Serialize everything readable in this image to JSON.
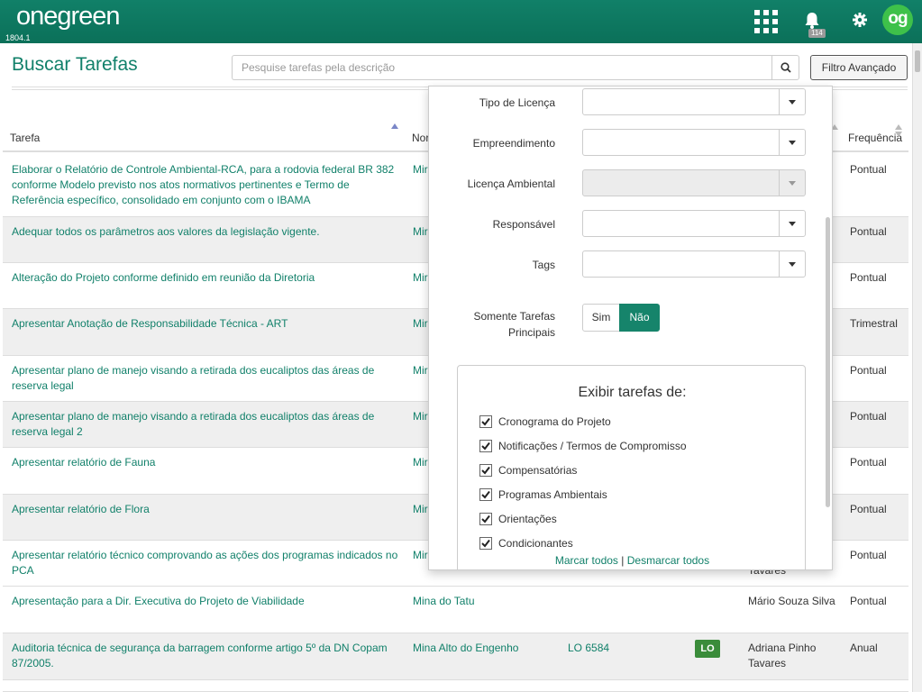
{
  "app": {
    "logo": "onegreen",
    "version": "1804.1",
    "notifications_count": "114",
    "avatar_initials": "og",
    "brand_color": "#0d7a63"
  },
  "header": {
    "title": "Buscar Tarefas",
    "search_placeholder": "Pesquise tarefas pela descrição",
    "advanced_filter_label": "Filtro Avançado"
  },
  "table": {
    "columns": {
      "task": "Tarefa",
      "name": "Nor",
      "frequency": "Frequência"
    },
    "rows": [
      {
        "task": "Elaborar o Relatório de Controle Ambiental-RCA, para a rodovia federal BR 382 conforme Modelo previsto nos atos normativos pertinentes e Termo de Referência específico, consolidado em conjunto com o IBAMA",
        "emp": "Mir",
        "freq": "Pontual"
      },
      {
        "task": "Adequar todos os parâmetros aos valores da legislação vigente.",
        "emp": "Mir",
        "freq": "Pontual"
      },
      {
        "task": "Alteração do Projeto conforme definido em reunião da Diretoria",
        "emp": "Mir",
        "freq": "Pontual"
      },
      {
        "task": "Apresentar Anotação de Responsabilidade Técnica - ART",
        "emp": "Mir",
        "freq": "Trimestral"
      },
      {
        "task": "Apresentar plano de manejo visando a retirada dos eucaliptos das áreas de reserva legal",
        "emp": "Mir",
        "freq": "Pontual"
      },
      {
        "task": "Apresentar plano de manejo visando a retirada dos eucaliptos das áreas de reserva legal 2",
        "emp": "Mir",
        "freq": "Pontual"
      },
      {
        "task": "Apresentar relatório de Fauna",
        "emp": "Mir",
        "freq": "Pontual"
      },
      {
        "task": "Apresentar relatório de Flora",
        "emp": "Mir",
        "freq": "Pontual"
      },
      {
        "task": "Apresentar relatório técnico comprovando as ações dos programas indicados no PCA",
        "emp": "Mir",
        "resp": "Tavares",
        "freq": "Pontual"
      },
      {
        "task": "Apresentação para a Dir. Executiva do Projeto de Viabilidade",
        "emp": "Mina do Tatu",
        "resp": "Mário Souza Silva",
        "freq": "Pontual"
      },
      {
        "task": "Auditoria técnica de segurança da barragem conforme artigo 5º da DN Copam 87/2005.",
        "emp": "Mina Alto do Engenho",
        "lic": "LO 6584",
        "badge": "LO",
        "resp": "Adriana Pinho Tavares",
        "freq": "Anual"
      }
    ]
  },
  "filter_panel": {
    "license_type_label": "Tipo de Licença",
    "enterprise_label": "Empreendimento",
    "env_license_label": "Licença Ambiental",
    "responsible_label": "Responsável",
    "tags_label": "Tags",
    "main_tasks_label_1": "Somente Tarefas",
    "main_tasks_label_2": "Principais",
    "toggle_yes": "Sim",
    "toggle_no": "Não",
    "toggle_selected": "Não",
    "show_tasks_title": "Exibir tarefas de:",
    "checkboxes": [
      {
        "label": "Cronograma do Projeto",
        "checked": true
      },
      {
        "label": "Notificações / Termos de Compromisso",
        "checked": true
      },
      {
        "label": "Compensatórias",
        "checked": true
      },
      {
        "label": "Programas Ambientais",
        "checked": true
      },
      {
        "label": "Orientações",
        "checked": true
      },
      {
        "label": "Condicionantes",
        "checked": true
      }
    ],
    "check_all": "Marcar todos",
    "separator": "|",
    "uncheck_all": "Desmarcar todos"
  }
}
